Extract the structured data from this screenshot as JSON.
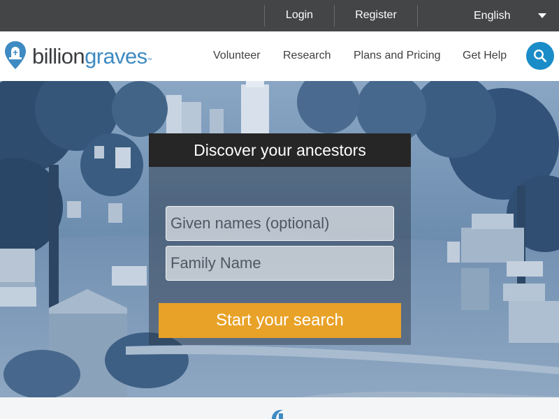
{
  "topbar": {
    "login_label": "Login",
    "register_label": "Register",
    "language": "English"
  },
  "logo": {
    "part1": "billion",
    "part2": "graves",
    "trademark": "™"
  },
  "nav": {
    "items": [
      {
        "label": "Volunteer"
      },
      {
        "label": "Research"
      },
      {
        "label": "Plans and Pricing"
      },
      {
        "label": "Get Help"
      }
    ],
    "search_icon": "search-icon"
  },
  "hero": {
    "title": "Discover your ancestors",
    "given_placeholder": "Given names (optional)",
    "family_placeholder": "Family Name",
    "search_button": "Start your search"
  },
  "colors": {
    "topbar_bg": "#444547",
    "accent_blue": "#1a8cc8",
    "cta_orange": "#e8a227",
    "card_header": "#262626",
    "hero_tint": "#5b7fa3"
  }
}
